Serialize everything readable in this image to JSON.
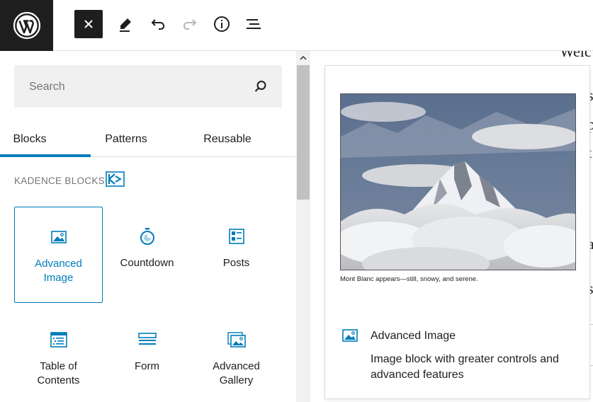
{
  "toolbar": {
    "logo": "wordpress-logo",
    "buttons": [
      "close-icon",
      "pen-icon",
      "undo-icon",
      "redo-icon",
      "info-icon",
      "list-view-icon"
    ]
  },
  "inserter": {
    "search_placeholder": "Search",
    "tabs": [
      {
        "label": "Blocks",
        "active": true
      },
      {
        "label": "Patterns",
        "active": false
      },
      {
        "label": "Reusable",
        "active": false
      }
    ],
    "category": "KADENCE BLOCKS",
    "blocks": [
      {
        "label": "Advanced Image",
        "icon": "image-icon",
        "selected": true
      },
      {
        "label": "Countdown",
        "icon": "countdown-icon",
        "selected": false
      },
      {
        "label": "Posts",
        "icon": "posts-icon",
        "selected": false
      },
      {
        "label": "Table of Contents",
        "icon": "table-of-contents-icon",
        "selected": false
      },
      {
        "label": "Form",
        "icon": "form-icon",
        "selected": false
      },
      {
        "label": "Advanced Gallery",
        "icon": "gallery-icon",
        "selected": false
      }
    ]
  },
  "editor": {
    "partial_heading": "Welc",
    "edge_chars": [
      "s",
      "p",
      "t",
      "a",
      "s"
    ]
  },
  "preview": {
    "caption": "Mont Blanc appears—still, snowy, and serene.",
    "title": "Advanced Image",
    "description": "Image block with greater controls and advanced features"
  },
  "colors": {
    "accent": "#007cba",
    "dark": "#1e1e1e",
    "muted": "#757575"
  }
}
